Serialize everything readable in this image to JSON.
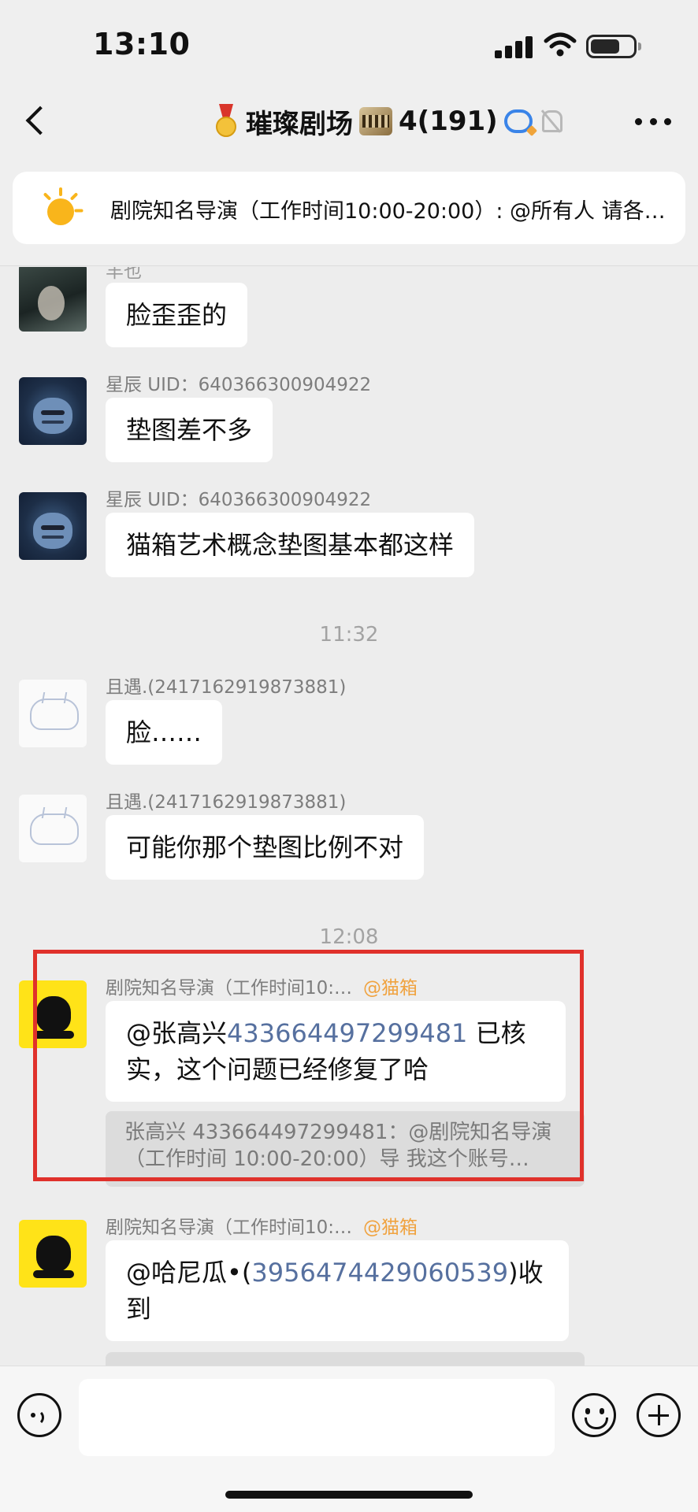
{
  "status_bar": {
    "time": "13:10"
  },
  "header": {
    "title": "璀璨剧场",
    "member_count": "4(191)",
    "icons": [
      "back-icon",
      "medal-icon",
      "film-icon",
      "chat-bubble-icon",
      "mute-bell-icon",
      "more-icon"
    ]
  },
  "pinned_notice": {
    "text": "剧院知名导演（工作时间10:00-20:00）: @所有人 请各…"
  },
  "messages": [
    {
      "sender": "羊也",
      "text": "脸歪歪的"
    },
    {
      "sender": "星辰 UID：640366300904922",
      "text": "垫图差不多"
    },
    {
      "sender": "星辰 UID：640366300904922",
      "text": "猫箱艺术概念垫图基本都这样"
    },
    {
      "divider": "11:32"
    },
    {
      "sender": "且遇.(2417162919873881)",
      "text": "脸……"
    },
    {
      "sender": "且遇.(2417162919873881)",
      "text": "可能你那个垫图比例不对"
    },
    {
      "divider": "12:08"
    },
    {
      "sender": "剧院知名导演（工作时间10:…",
      "role": "@猫箱",
      "mention": "@张高兴",
      "uid": "433664497299481",
      "text_after": " 已核实，这个问题已经修复了哈",
      "quote": "张高兴 433664497299481：@剧院知名导演（工作时间 10:00-20:00）导 我这个账号…"
    },
    {
      "sender": "剧院知名导演（工作时间10:…",
      "role": "@猫箱",
      "mention": "@哈尼瓜•(",
      "uid": "3956474429060539",
      "text_after": ")收到"
    }
  ],
  "input_bar": {
    "placeholder": ""
  },
  "colors": {
    "accent_link": "#56709f",
    "role_tag": "#f0a340",
    "highlight_box": "#e0312b"
  }
}
